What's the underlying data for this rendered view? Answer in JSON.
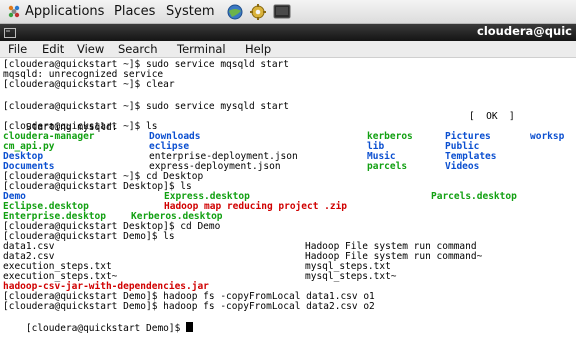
{
  "panel": {
    "applications": "Applications",
    "places": "Places",
    "system": "System"
  },
  "window": {
    "title": "cloudera@quic"
  },
  "menu": [
    "File",
    "Edit",
    "View",
    "Search",
    "Terminal",
    "Help"
  ],
  "terminal": {
    "lines": [
      "[cloudera@quickstart ~]$ sudo service mqsqld start",
      "mqsqld: unrecognized service",
      "[cloudera@quickstart ~]$ clear",
      "",
      "[cloudera@quickstart ~]$ sudo service mysqld start",
      "Starting mysqld:",
      "[cloudera@quickstart ~]$ ls",
      "",
      "",
      "",
      "",
      "[cloudera@quickstart ~]$ cd Desktop",
      "[cloudera@quickstart Desktop]$ ls",
      "",
      "",
      "",
      "[cloudera@quickstart Desktop]$ cd Demo",
      "[cloudera@quickstart Demo]$ ls",
      "",
      "",
      "",
      "",
      "",
      "[cloudera@quickstart Demo]$ hadoop fs -copyFromLocal data1.csv o1",
      "[cloudera@quickstart Demo]$ hadoop fs -copyFromLocal data2.csv o2",
      "[cloudera@quickstart Demo]$ "
    ],
    "ok_status": "[  OK  ]",
    "home_listing": [
      {
        "name": "cloudera-manager",
        "color": "green"
      },
      {
        "name": "Downloads",
        "color": "blue"
      },
      {
        "name": "kerberos",
        "color": "green"
      },
      {
        "name": "Pictures",
        "color": "blue"
      },
      {
        "name": "worksp",
        "color": "blue"
      },
      {
        "name": "cm_api.py",
        "color": "green"
      },
      {
        "name": "eclipse",
        "color": "blue"
      },
      {
        "name": "lib",
        "color": "blue"
      },
      {
        "name": "Public",
        "color": "blue"
      },
      {
        "name": "Desktop",
        "color": "blue"
      },
      {
        "name": "enterprise-deployment.json",
        "color": "plain"
      },
      {
        "name": "Music",
        "color": "blue"
      },
      {
        "name": "Templates",
        "color": "blue"
      },
      {
        "name": "Documents",
        "color": "blue"
      },
      {
        "name": "express-deployment.json",
        "color": "plain"
      },
      {
        "name": "parcels",
        "color": "green"
      },
      {
        "name": "Videos",
        "color": "blue"
      }
    ],
    "desktop_listing": [
      {
        "name": "Demo",
        "color": "blue"
      },
      {
        "name": "Express.desktop",
        "color": "green"
      },
      {
        "name": "Parcels.desktop",
        "color": "green"
      },
      {
        "name": "Eclipse.desktop",
        "color": "green"
      },
      {
        "name": "Hadoop map reducing project .zip",
        "color": "red"
      },
      {
        "name": "Enterprise.desktop",
        "color": "green"
      },
      {
        "name": "Kerberos.desktop",
        "color": "green"
      }
    ],
    "demo_listing": [
      {
        "name": "data1.csv",
        "color": "plain"
      },
      {
        "name": "Hadoop File system run command",
        "color": "plain"
      },
      {
        "name": "data2.csv",
        "color": "plain"
      },
      {
        "name": "Hadoop File system run command~",
        "color": "plain"
      },
      {
        "name": "execution_steps.txt",
        "color": "plain"
      },
      {
        "name": "mysql_steps.txt",
        "color": "plain"
      },
      {
        "name": "execution_steps.txt~",
        "color": "plain"
      },
      {
        "name": "mysql_steps.txt~",
        "color": "plain"
      },
      {
        "name": "hadoop-csv-jar-with-dependencies.jar",
        "color": "red"
      }
    ]
  }
}
